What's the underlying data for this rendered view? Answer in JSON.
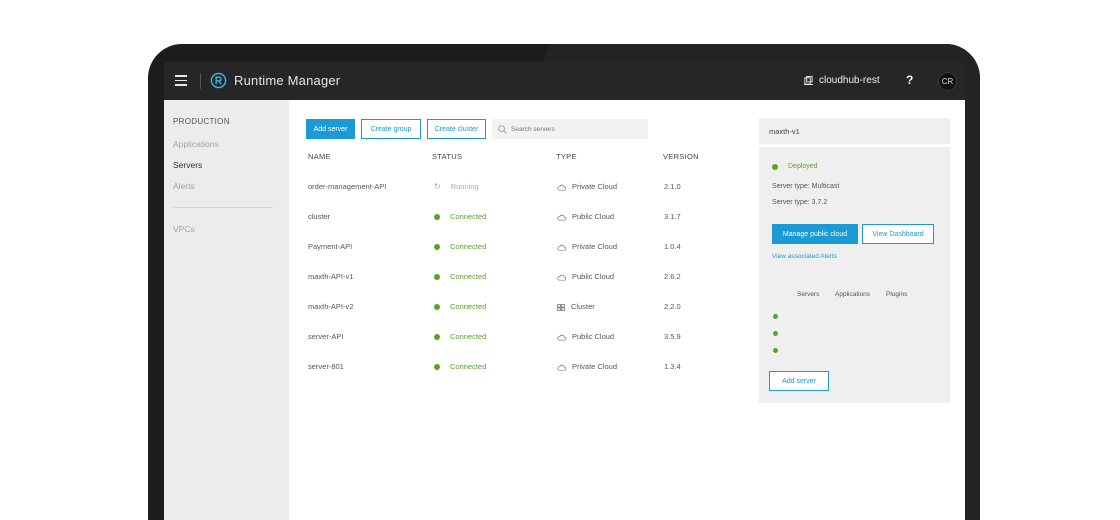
{
  "app": {
    "title": "Runtime Manager",
    "org": "cloudhub-rest",
    "help": "?",
    "avatar": "CR"
  },
  "sidebar": {
    "section": "PRODUCTION",
    "items": [
      "Applications",
      "Servers",
      "Alerts",
      "VPCs"
    ],
    "active": "Servers"
  },
  "toolbar": {
    "add_server": "Add server",
    "create_group": "Create group",
    "create_cluster": "Create cluster",
    "search_placeholder": "Search servers"
  },
  "table": {
    "headers": [
      "NAME",
      "STATUS",
      "TYPE",
      "VERSION"
    ],
    "rows": [
      {
        "name": "order-management-API",
        "status": "Running",
        "type": "Private Cloud",
        "version": "2.1.0"
      },
      {
        "name": "cluster",
        "status": "Connected",
        "type": "Public Cloud",
        "version": "3.1.7"
      },
      {
        "name": "Payment-API",
        "status": "Connected",
        "type": "Private Cloud",
        "version": "1.0.4"
      },
      {
        "name": "maxth-API-v1",
        "status": "Connected",
        "type": "Public Cloud",
        "version": "2.6.2"
      },
      {
        "name": "maxth-API-v2",
        "status": "Connected",
        "type": "Cluster",
        "version": "2.2.0"
      },
      {
        "name": "server-API",
        "status": "Connected",
        "type": "Public Cloud",
        "version": "3.5.9"
      },
      {
        "name": "server-801",
        "status": "Connected",
        "type": "Private Cloud",
        "version": "1.3.4"
      }
    ]
  },
  "details": {
    "title": "maxth-v1",
    "status": "Deployed",
    "server_type": "Server type:  Multicast",
    "server_version": "Server type:  3.7.2",
    "manage_button": "Manage public cloud",
    "dashboard_button": "View Dashboard",
    "alerts_link": "View associated Alerts",
    "tabs": [
      "Servers",
      "Applications",
      "Plugins"
    ],
    "add_server": "Add server"
  },
  "colors": {
    "accent": "#1c9ad6",
    "status_green": "#5aa51f",
    "topbar": "#262628",
    "sidebar": "#ebeded"
  }
}
